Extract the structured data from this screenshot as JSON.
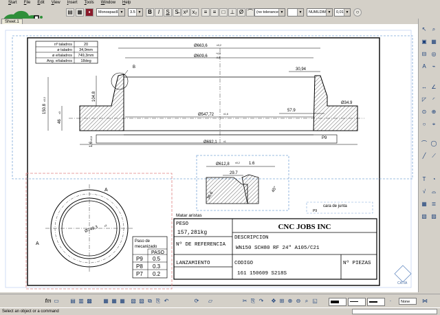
{
  "menu": {
    "items": [
      "Start",
      "File",
      "Edit",
      "View",
      "Insert",
      "Tools",
      "Window",
      "Help"
    ]
  },
  "toolbar": {
    "font_value": "Monospac821",
    "size_value": "3.5",
    "bold": "B",
    "italic": "I",
    "underline": "S",
    "tolerance_value": "(no tolerance)",
    "numbering_value": "NUMLDIMM",
    "precision_value": "0,010"
  },
  "tabs": {
    "sheet": "Sheet.1"
  },
  "drawing": {
    "holes_table": {
      "rows": [
        {
          "label": "nº taladros",
          "value": "20"
        },
        {
          "label": "ø taladro",
          "value": "34,9mm"
        },
        {
          "label": "ø e/taladros",
          "value": "749,3mm"
        },
        {
          "label": "Ang. e/taladros",
          "value": "18deg"
        }
      ]
    },
    "dims": {
      "d1": "Ø663,6",
      "d1_tol": "±3,2",
      "d2": "Ø609,6",
      "d2_tol_up": "+4,8",
      "d2_tol_dn": "-0,8",
      "d3": "30,94",
      "d4": "Ø547,72",
      "d4_tol": "±1,6",
      "d5": "57.9",
      "d6": "Ø34.9",
      "d7": "Ø692,1",
      "d7_tol": "±1",
      "v1": "150.8",
      "v1_tol": "±3.2",
      "v2": "104.8",
      "v3": "46",
      "v3_tol": "±3",
      "v4": "1,6",
      "v4_tol": "±0,8",
      "detail_label_b": "B",
      "p9": "P9",
      "detail_d": "Ø612,8",
      "detail_d_tol": "±0,2",
      "detail_16": "1.6",
      "detail_297": "29.7",
      "detail_ang1": "36,6",
      "detail_ang2": "45°",
      "section_a": "A",
      "front_dia": "Ø749,3",
      "front_dia_tol": "±3"
    },
    "notes": {
      "junta": "cara de junta",
      "p9_small": "P9",
      "aristas": "Matar aristas"
    },
    "paso": {
      "title": "Paso de\nmecanizado",
      "header": "PASO",
      "rows": [
        {
          "p": "P9",
          "v": "0.5"
        },
        {
          "p": "P8",
          "v": "0.3"
        },
        {
          "p": "P7",
          "v": "0.2"
        }
      ]
    },
    "title_block": {
      "company": "CNC JOBS INC",
      "peso_label": "PESO",
      "peso_value": "157,281kg",
      "ref_label": "Nº DE REFERENCIA",
      "desc_label": "DESCRIPCION",
      "desc_value": "WN150 SCH80 RF 24\" A105/C21",
      "lanz_label": "LANZAMIENTO",
      "codigo_label": "CODIGO",
      "codigo_value": "161 150609 S218S",
      "piezas_label": "Nº PIEZAS"
    }
  },
  "bottom_toolbar": {
    "fm": "fm",
    "linetype": "None"
  },
  "status": {
    "message": "Select an object or a command"
  },
  "watermark": {
    "brand": "CATIA"
  }
}
